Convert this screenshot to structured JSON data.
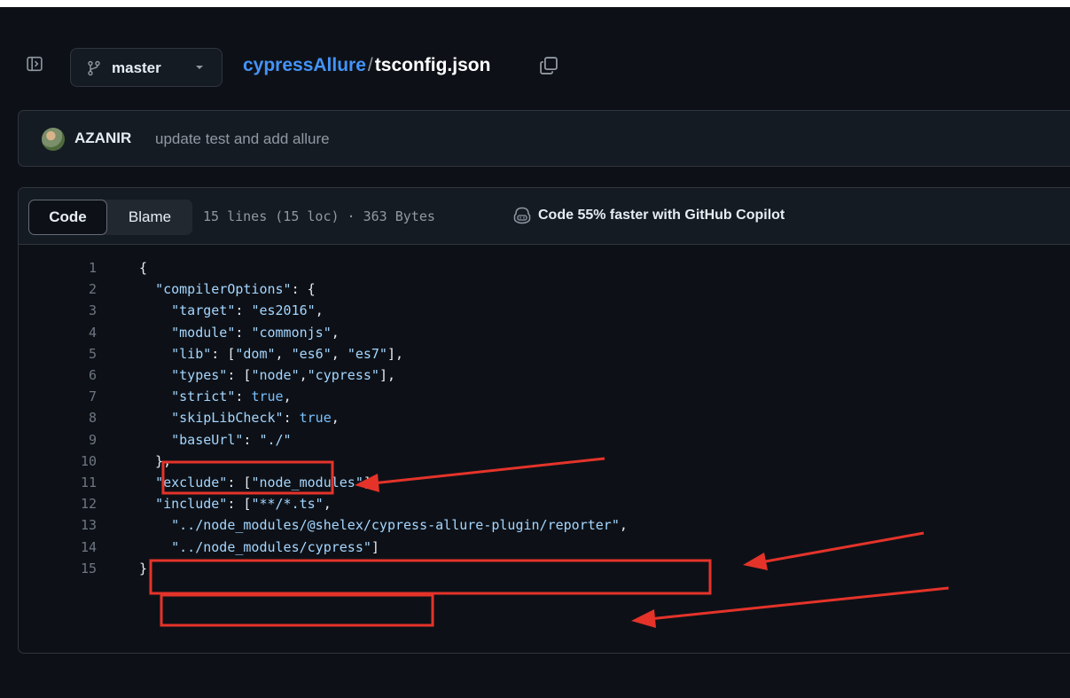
{
  "header": {
    "branch": "master",
    "repo": "cypressAllure",
    "separator": "/",
    "file": "tsconfig.json"
  },
  "commit": {
    "author": "AZANIR",
    "message": "update test and add allure"
  },
  "code_header": {
    "code_tab": "Code",
    "blame_tab": "Blame",
    "file_meta": "15 lines (15 loc) · 363 Bytes",
    "copilot": "Code 55% faster with GitHub Copilot"
  },
  "icons": [
    "panel-toggle-icon",
    "git-branch-icon",
    "caret-down-icon",
    "copy-icon",
    "copilot-icon"
  ],
  "colors": {
    "background": "#0d1117",
    "link": "#4493f8",
    "json_string": "#a5d6ff",
    "boolean": "#79c0ff",
    "annotation": "#e5332a"
  },
  "code": [
    {
      "n": "1",
      "text": "{"
    },
    {
      "n": "2",
      "text": "  \"compilerOptions\": {"
    },
    {
      "n": "3",
      "text": "    \"target\": \"es2016\","
    },
    {
      "n": "4",
      "text": "    \"module\": \"commonjs\","
    },
    {
      "n": "5",
      "text": "    \"lib\": [\"dom\", \"es6\", \"es7\"],"
    },
    {
      "n": "6",
      "text": "    \"types\": [\"node\",\"cypress\"],"
    },
    {
      "n": "7",
      "text": "    \"strict\": true,"
    },
    {
      "n": "8",
      "text": "    \"skipLibCheck\": true,"
    },
    {
      "n": "9",
      "text": "    \"baseUrl\": \"./\""
    },
    {
      "n": "10",
      "text": "  },"
    },
    {
      "n": "11",
      "text": "  \"exclude\": [\"node_modules\"],"
    },
    {
      "n": "12",
      "text": "  \"include\": [\"**/*.ts\","
    },
    {
      "n": "13",
      "text": "    \"../node_modules/@shelex/cypress-allure-plugin/reporter\","
    },
    {
      "n": "14",
      "text": "    \"../node_modules/cypress\"]"
    },
    {
      "n": "15",
      "text": "}"
    }
  ]
}
